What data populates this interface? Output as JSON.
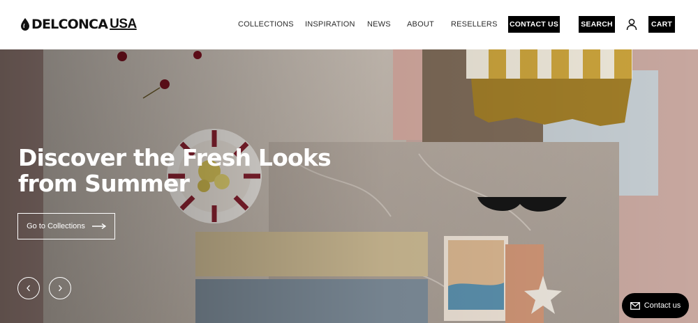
{
  "header": {
    "logo": {
      "brand": "DELCONCA",
      "region": "USA"
    },
    "nav": [
      {
        "label": "COLLECTIONS"
      },
      {
        "label": "INSPIRATION"
      },
      {
        "label": "NEWS"
      },
      {
        "label": "ABOUT"
      },
      {
        "label": "RESELLERS"
      }
    ],
    "contact_label": "CONTACT US",
    "search_label": "SEARCH",
    "cart_label": "CART",
    "user_icon": "user-icon"
  },
  "hero": {
    "title": "Discover the Fresh Looks from Summer",
    "cta_label": "Go to Collections",
    "cta_icon": "arrow-right-icon",
    "prev_icon": "chevron-left-icon",
    "next_icon": "chevron-right-icon"
  },
  "chat": {
    "label": "Contact us",
    "icon": "mail-icon"
  },
  "colors": {
    "header_bg": "#ffffff",
    "button_bg": "#000000",
    "hero_text": "#ffffff"
  }
}
